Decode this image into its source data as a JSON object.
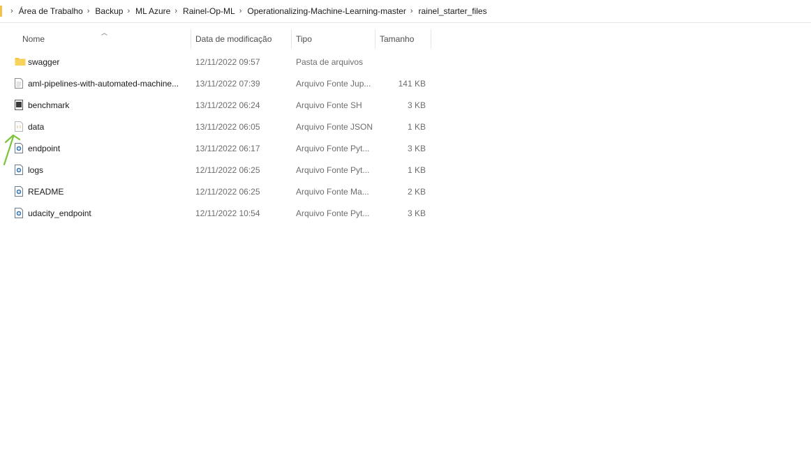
{
  "breadcrumb": {
    "items": [
      "Área de Trabalho",
      "Backup",
      "ML Azure",
      "Rainel-Op-ML",
      "Operationalizing-Machine-Learning-master",
      "rainel_starter_files"
    ],
    "separator": "›"
  },
  "columns": {
    "name": "Nome",
    "date": "Data de modificação",
    "type": "Tipo",
    "size": "Tamanho",
    "sort_icon": "chevron-up-icon"
  },
  "files": [
    {
      "name": "swagger",
      "date": "12/11/2022 09:57",
      "type": "Pasta de arquivos",
      "size": "",
      "icon": "folder-icon"
    },
    {
      "name": "aml-pipelines-with-automated-machine...",
      "date": "13/11/2022 07:39",
      "type": "Arquivo Fonte Jup...",
      "size": "141 KB",
      "icon": "document-icon"
    },
    {
      "name": "benchmark",
      "date": "13/11/2022 06:24",
      "type": "Arquivo Fonte SH",
      "size": "3 KB",
      "icon": "terminal-script-icon"
    },
    {
      "name": "data",
      "date": "13/11/2022 06:05",
      "type": "Arquivo Fonte JSON",
      "size": "1 KB",
      "icon": "json-file-icon"
    },
    {
      "name": "endpoint",
      "date": "13/11/2022 06:17",
      "type": "Arquivo Fonte Pyt...",
      "size": "3 KB",
      "icon": "python-file-icon"
    },
    {
      "name": "logs",
      "date": "12/11/2022 06:25",
      "type": "Arquivo Fonte Pyt...",
      "size": "1 KB",
      "icon": "python-file-icon"
    },
    {
      "name": "README",
      "date": "12/11/2022 06:25",
      "type": "Arquivo Fonte Ma...",
      "size": "2 KB",
      "icon": "markdown-file-icon"
    },
    {
      "name": "udacity_endpoint",
      "date": "12/11/2022 10:54",
      "type": "Arquivo Fonte Pyt...",
      "size": "3 KB",
      "icon": "python-file-icon"
    }
  ],
  "annotation": {
    "icon": "green-arrow-icon",
    "color": "#7cc33a"
  },
  "colors": {
    "folder": "#f3c744",
    "text": "#1a1a1a",
    "muted": "#6d6d6d",
    "python_blue": "#3a7ab8"
  }
}
